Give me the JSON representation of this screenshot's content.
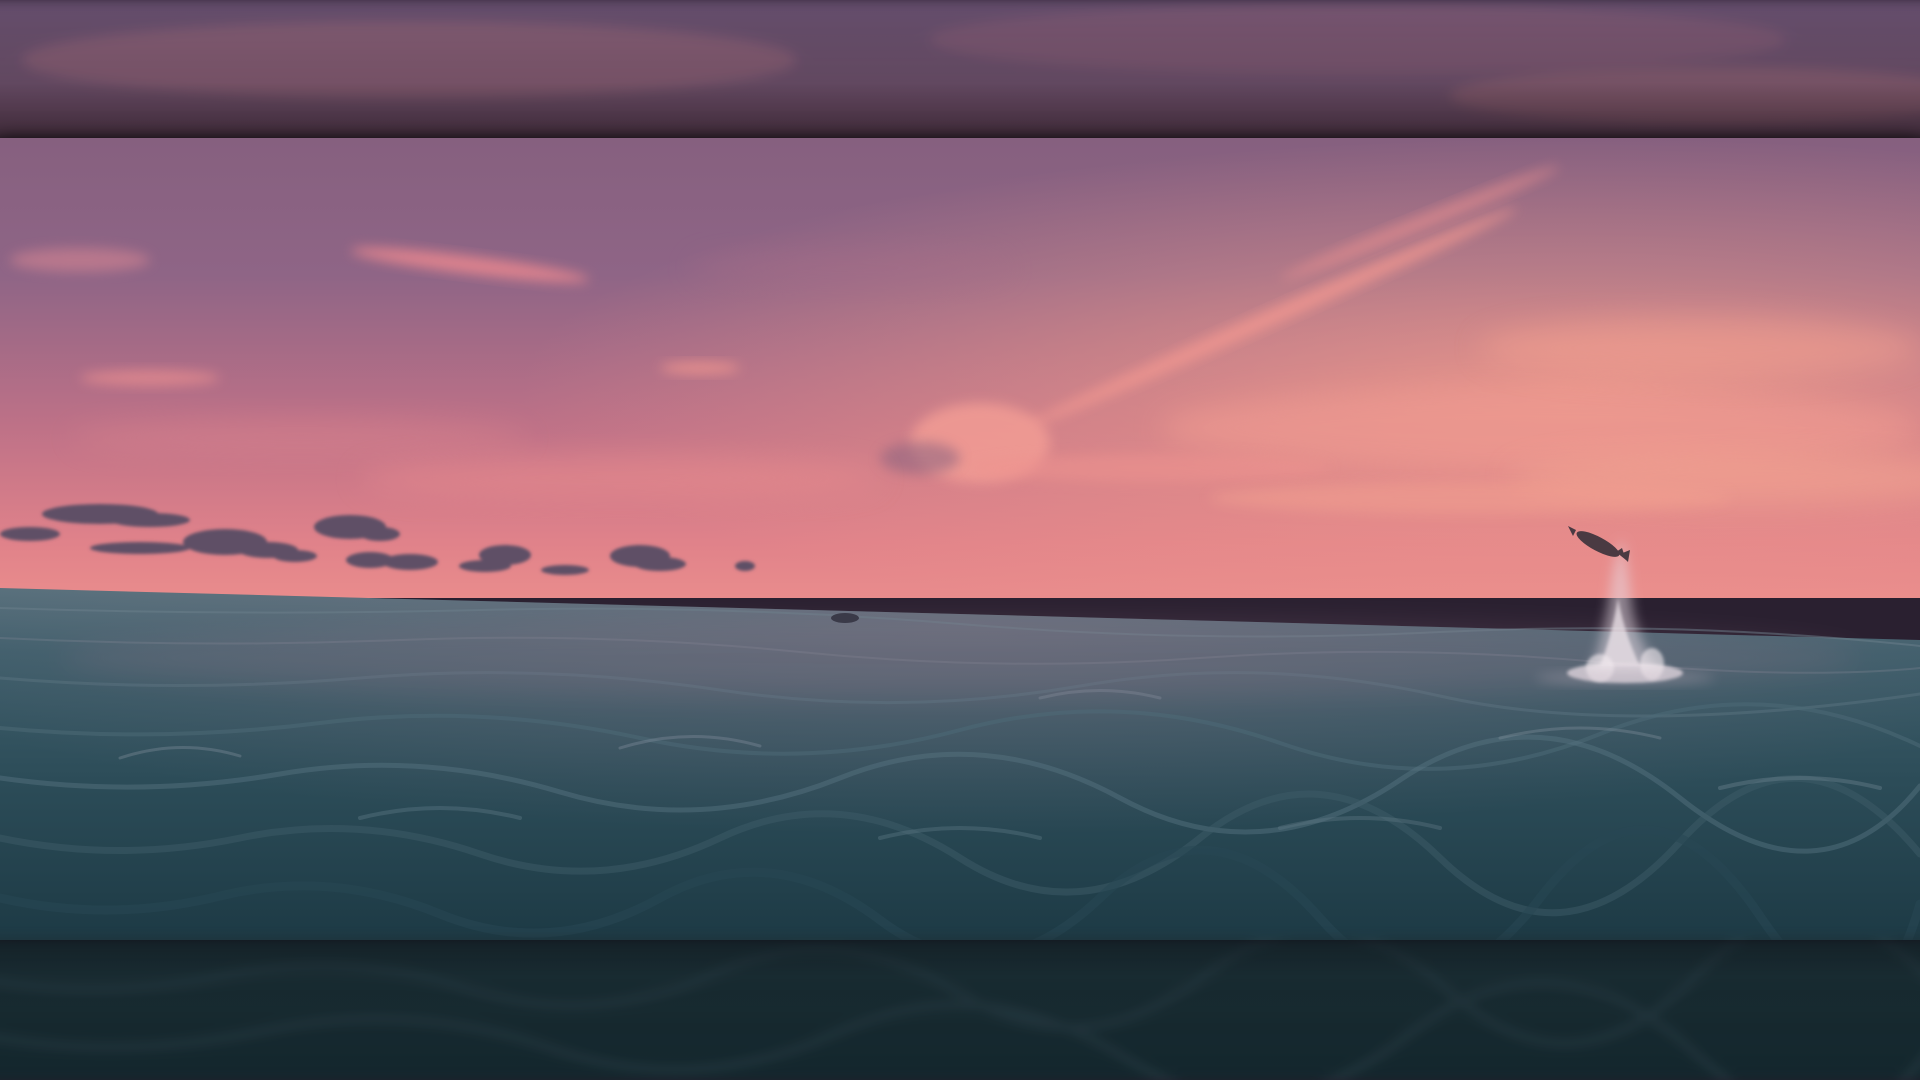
{
  "scene": {
    "subject": "dolphin-leaping",
    "setting": "open-ocean-at-sunset",
    "colors": {
      "sky_top": "#7e5f86",
      "sky_mid": "#b3708c",
      "sky_horizon": "#e7848a",
      "cloud_pink": "#f2968f",
      "cloud_dark": "#5b4c63",
      "sea_far": "#4c6a76",
      "sea_near": "#1f3e48",
      "splash": "#e9dfe6"
    }
  }
}
